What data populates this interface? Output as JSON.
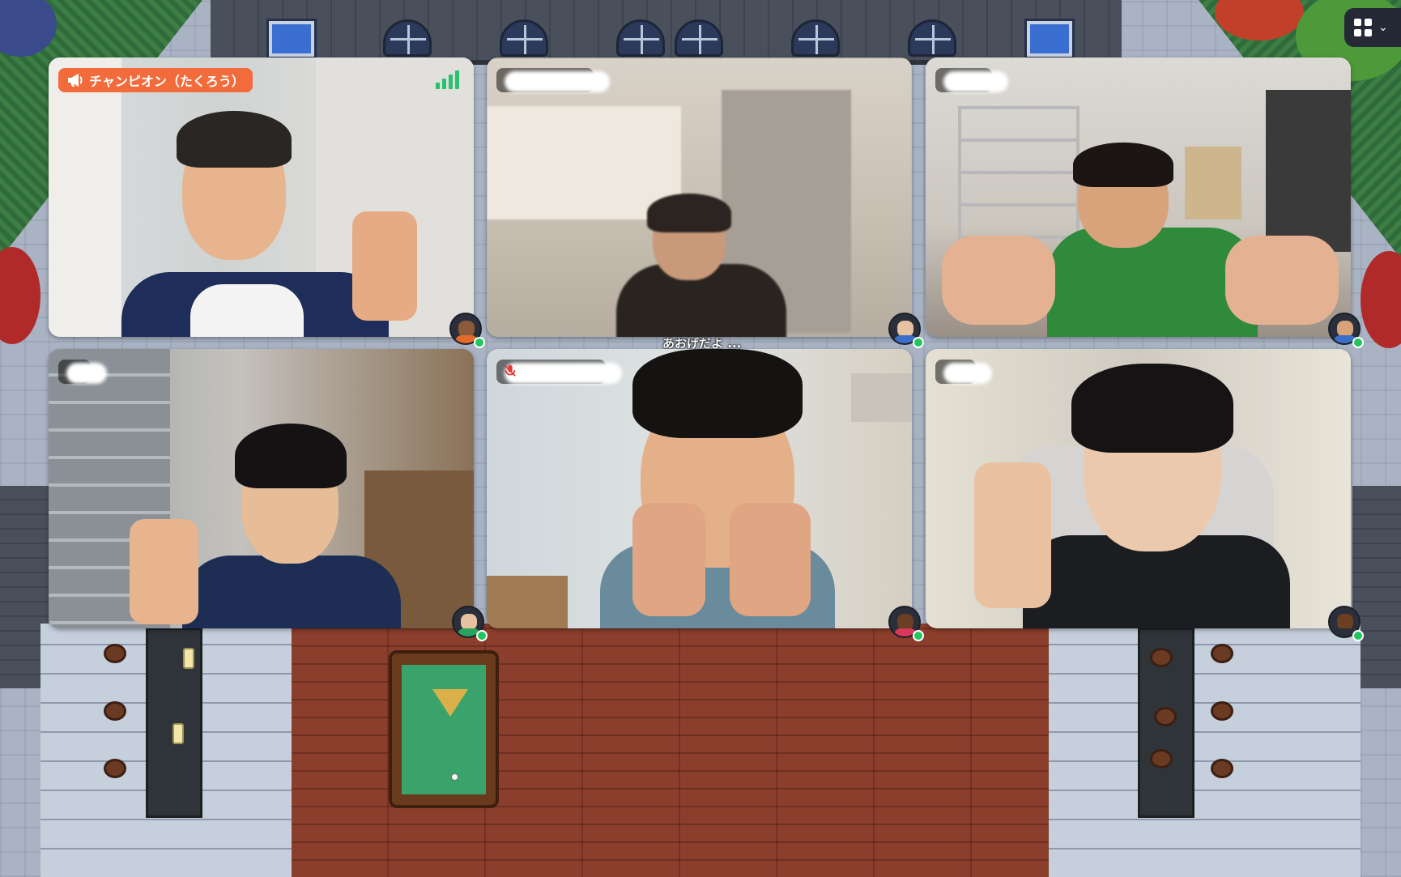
{
  "app": {
    "menu_button": {
      "icon": "grid-icon",
      "chevron": "chevron-down-icon"
    }
  },
  "map": {
    "player_label": "あおげだよ",
    "player_label_suffix": "..."
  },
  "tiles": [
    {
      "name": "チャンピオン（たくろう）",
      "name_visible": true,
      "spotlight": true,
      "name_icon": "megaphone-icon",
      "signal_bars": 3,
      "muted": false,
      "avatar": {
        "skin": "#8a5a3a",
        "shirt": "#e46a2c"
      }
    },
    {
      "name": "",
      "name_visible": false,
      "spotlight": false,
      "muted": false,
      "avatar": {
        "skin": "#e6c2a0",
        "shirt": "#3b6fc9"
      }
    },
    {
      "name": "",
      "name_visible": false,
      "spotlight": false,
      "muted": false,
      "avatar": {
        "skin": "#d8a27a",
        "shirt": "#3b6fc9"
      }
    },
    {
      "name": "",
      "name_visible": false,
      "spotlight": false,
      "muted": false,
      "avatar": {
        "skin": "#e6c2a0",
        "shirt": "#28a35b"
      }
    },
    {
      "name": "",
      "name_visible": false,
      "spotlight": false,
      "muted": true,
      "mute_icon": "mic-off-icon",
      "avatar": {
        "skin": "#6b3f22",
        "shirt": "#d9375b"
      }
    },
    {
      "name": "",
      "name_visible": false,
      "spotlight": false,
      "muted": false,
      "avatar": {
        "skin": "#6b3f22",
        "shirt": "#2a2f3b"
      }
    }
  ],
  "colors": {
    "spotlight": "#f26b3a",
    "online": "#22c55e",
    "signal": "#27c26e"
  }
}
